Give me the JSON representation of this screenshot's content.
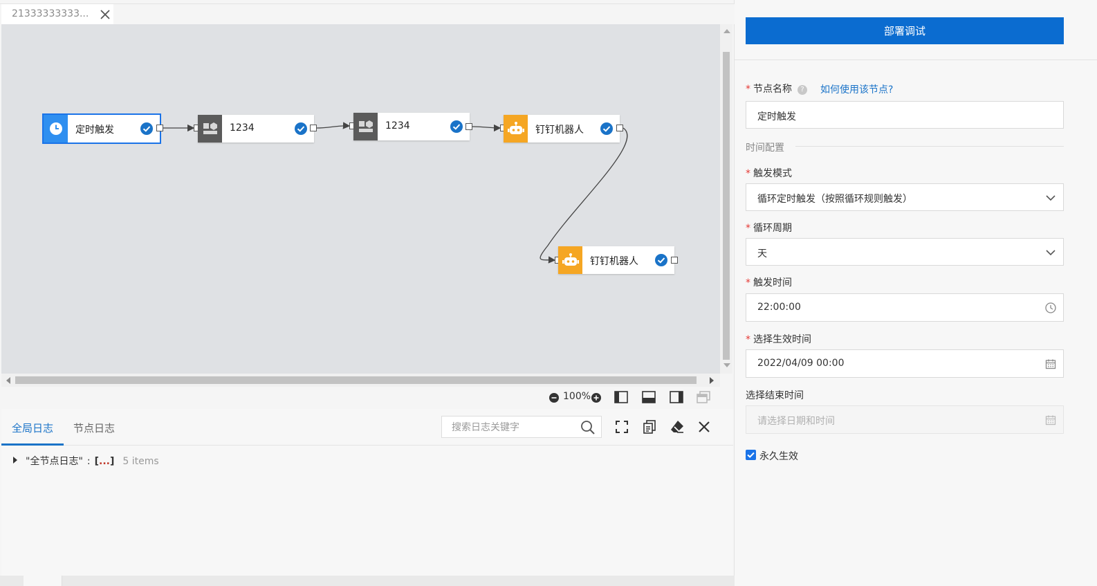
{
  "tab": {
    "label": "21333333333...",
    "close_glyph": "✕"
  },
  "canvas": {
    "nodes": [
      {
        "id": "n1",
        "label": "定时触发",
        "icon": "clock-icon",
        "icon_bg": "#2f8ff0"
      },
      {
        "id": "n2",
        "label": "1234",
        "icon": "blocks-icon",
        "icon_bg": "#5b5b5b"
      },
      {
        "id": "n3",
        "label": "1234",
        "icon": "blocks-icon",
        "icon_bg": "#5b5b5b"
      },
      {
        "id": "n4",
        "label": "钉钉机器人",
        "icon": "robot-icon",
        "icon_bg": "#f5a623"
      },
      {
        "id": "n5",
        "label": "钉钉机器人",
        "icon": "robot-icon",
        "icon_bg": "#f5a623"
      }
    ],
    "check_color": "#1a73c8"
  },
  "zoom": {
    "value": "100%"
  },
  "log": {
    "tabs": [
      "全局日志",
      "节点日志"
    ],
    "active_tab": 0,
    "search_placeholder": "搜索日志关键字",
    "entry": {
      "key": "\"全节点日志\"",
      "colon": ":",
      "open": "[",
      "ellipsis": "...",
      "close": "]",
      "count": "5 items"
    }
  },
  "panel": {
    "deploy_button": "部署调试",
    "node_name": {
      "label": "节点名称",
      "help_link": "如何使用该节点?",
      "value": "定时触发"
    },
    "section": "时间配置",
    "trigger_mode": {
      "label": "触发模式",
      "value": "循环定时触发（按照循环规则触发）"
    },
    "cycle": {
      "label": "循环周期",
      "value": "天"
    },
    "trigger_time": {
      "label": "触发时间",
      "value": "22:00:00"
    },
    "start_time": {
      "label": "选择生效时间",
      "value": "2022/04/09 00:00"
    },
    "end_time": {
      "label": "选择结束时间",
      "placeholder": "请选择日期和时间"
    },
    "forever": {
      "label": "永久生效",
      "checked": true
    }
  },
  "colors": {
    "accent": "#0b6cd0",
    "link": "#1a73c8",
    "required": "#e53935"
  }
}
